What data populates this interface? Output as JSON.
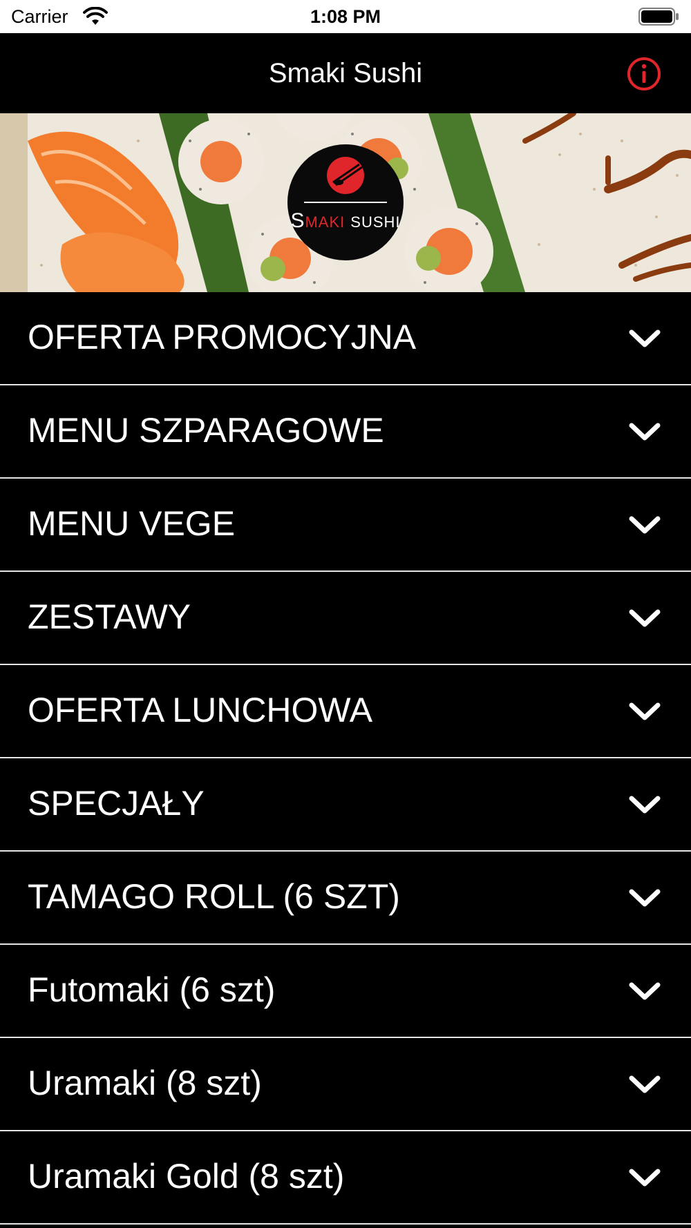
{
  "status_bar": {
    "carrier": "Carrier",
    "time": "1:08 PM",
    "wifi_icon": "wifi-icon",
    "battery_icon": "battery-icon"
  },
  "nav": {
    "title": "Smaki Sushi",
    "info_icon": "info-icon",
    "info_color": "#e0262b"
  },
  "banner": {
    "logo_text_s1": "S",
    "logo_text_maki": "MAKI",
    "logo_text_sushi": "SUSHI",
    "logo_accent": "#e0262b"
  },
  "menu": {
    "items": [
      {
        "label": "OFERTA PROMOCYJNA"
      },
      {
        "label": "MENU SZPARAGOWE"
      },
      {
        "label": "MENU VEGE"
      },
      {
        "label": "ZESTAWY"
      },
      {
        "label": "OFERTA LUNCHOWA"
      },
      {
        "label": "SPECJAŁY"
      },
      {
        "label": "TAMAGO ROLL (6 SZT)"
      },
      {
        "label": "Futomaki (6 szt)"
      },
      {
        "label": "Uramaki (8 szt)"
      },
      {
        "label": "Uramaki Gold (8 szt)"
      }
    ],
    "chevron_icon": "chevron-down-icon"
  }
}
